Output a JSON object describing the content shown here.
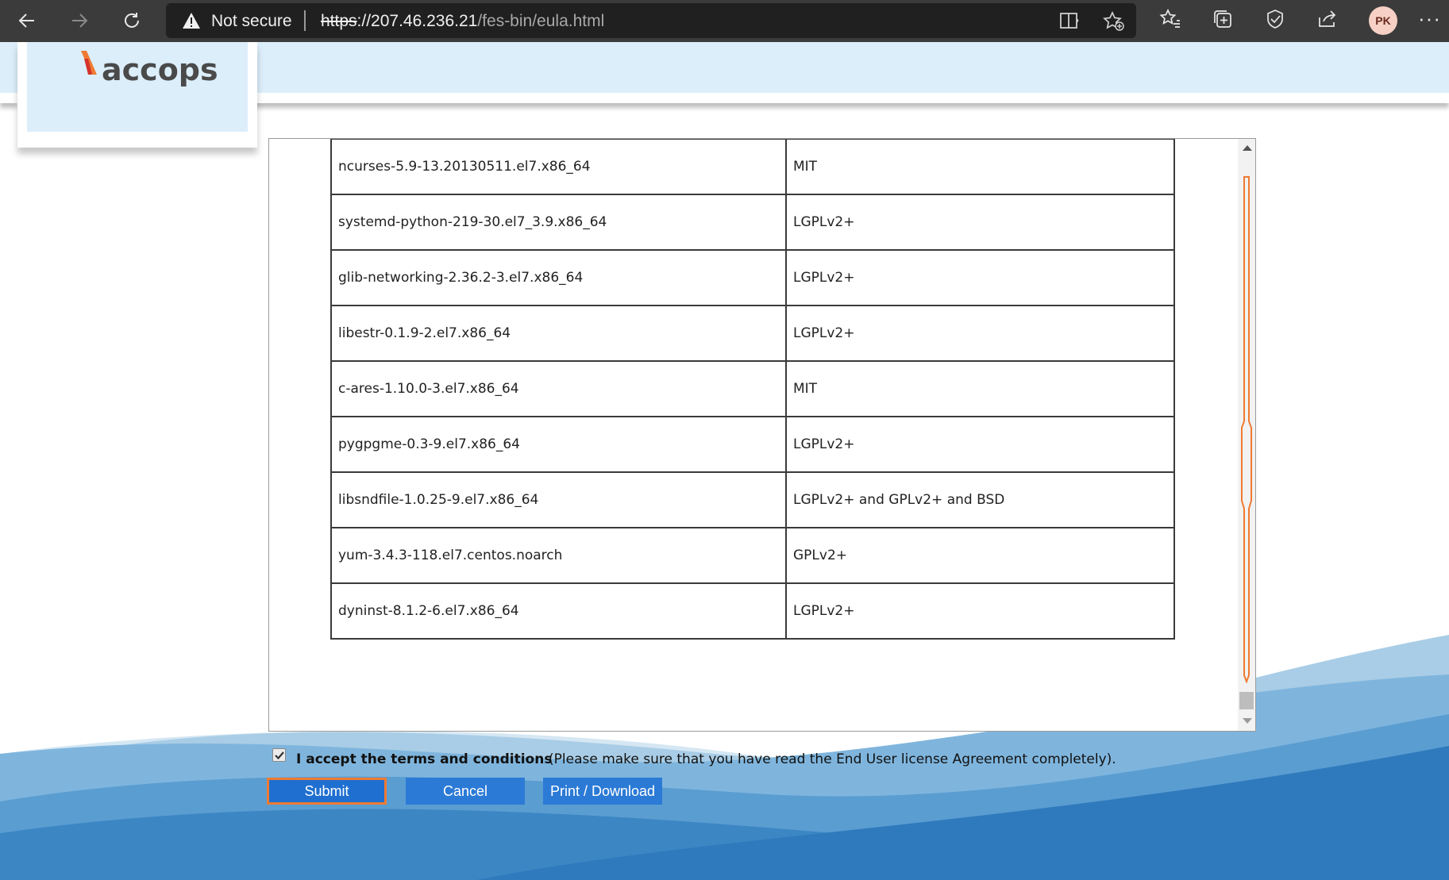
{
  "browser": {
    "security_label": "Not secure",
    "url_scheme": "https",
    "url_host": "://207.46.236.21",
    "url_path": "/fes-bin/eula.html",
    "profile_initials": "PK",
    "more_label": "···",
    "icons": [
      "back-icon",
      "forward-icon",
      "refresh-icon",
      "warning-icon",
      "read-aloud-icon",
      "add-favorite-icon",
      "favorites-icon",
      "collections-icon",
      "browser-essentials-icon",
      "share-icon"
    ]
  },
  "page": {
    "brand": "accops",
    "brand_colors": {
      "accent": "#ef7a32",
      "header_band": "#dceefa"
    }
  },
  "license_table": {
    "rows": [
      {
        "package": "ncurses-5.9-13.20130511.el7.x86_64",
        "license": "MIT"
      },
      {
        "package": "systemd-python-219-30.el7_3.9.x86_64",
        "license": "LGPLv2+"
      },
      {
        "package": "glib-networking-2.36.2-3.el7.x86_64",
        "license": "LGPLv2+"
      },
      {
        "package": "libestr-0.1.9-2.el7.x86_64",
        "license": "LGPLv2+"
      },
      {
        "package": "c-ares-1.10.0-3.el7.x86_64",
        "license": "MIT"
      },
      {
        "package": "pygpgme-0.3-9.el7.x86_64",
        "license": "LGPLv2+"
      },
      {
        "package": "libsndfile-1.0.25-9.el7.x86_64",
        "license": "LGPLv2+ and GPLv2+ and BSD"
      },
      {
        "package": "yum-3.4.3-118.el7.centos.noarch",
        "license": "GPLv2+"
      },
      {
        "package": "dyninst-8.1.2-6.el7.x86_64",
        "license": "LGPLv2+"
      }
    ]
  },
  "accept": {
    "checked": true,
    "bold_label": "I accept the terms and conditions",
    "note": "(Please make sure that you have read the End User license Agreement completely)."
  },
  "buttons": {
    "submit": "Submit",
    "cancel": "Cancel",
    "print": "Print / Download"
  }
}
